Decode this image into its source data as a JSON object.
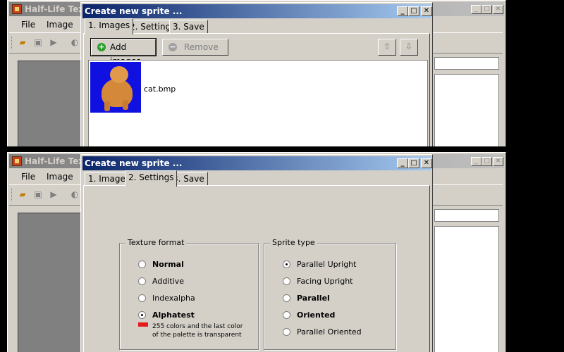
{
  "main_window": {
    "title": "Half-Life Textu",
    "menu": [
      "File",
      "Image"
    ]
  },
  "dialog": {
    "title": "Create new sprite ...",
    "tabs": [
      "1. Images",
      "2. Settings",
      "3. Save"
    ]
  },
  "images_tab": {
    "add_button": "Add images",
    "remove_button": "Remove",
    "move_up_icon": "arrow-up-icon",
    "move_down_icon": "arrow-down-icon",
    "items": [
      {
        "filename": "cat.bmp"
      }
    ]
  },
  "settings_tab": {
    "texture_format": {
      "label": "Texture format",
      "options": [
        "Normal",
        "Additive",
        "Indexalpha",
        "Alphatest"
      ],
      "selected": "Alphatest",
      "note_line1": "255 colors and the last color",
      "note_line2": "of the palette is transparent",
      "note_color": "#e41a1a"
    },
    "sprite_type": {
      "label": "Sprite type",
      "options": [
        "Parallel Upright",
        "Facing Upright",
        "Parallel",
        "Oriented",
        "Parallel Oriented"
      ],
      "selected": "Parallel Upright"
    }
  }
}
